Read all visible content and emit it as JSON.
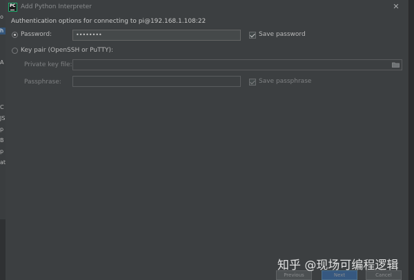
{
  "window": {
    "title": "Add Python Interpreter",
    "close_glyph": "✕"
  },
  "background_fragments": [
    "o",
    "h",
    "A",
    "C",
    "JS",
    "p",
    "B",
    "p",
    "at"
  ],
  "auth": {
    "header": "Authentication options for connecting to pi@192.168.1.108:22",
    "password_option": {
      "label": "Password:",
      "selected": true,
      "value": "••••••••",
      "save_label": "Save password",
      "save_checked": true
    },
    "keypair_option": {
      "label": "Key pair (OpenSSH or PuTTY):",
      "selected": false,
      "private_key_label": "Private key file:",
      "private_key_value": "",
      "passphrase_label": "Passphrase:",
      "passphrase_value": "",
      "save_passphrase_label": "Save passphrase",
      "save_passphrase_checked": true
    }
  },
  "footer": {
    "previous_label": "Previous",
    "next_label": "Next",
    "cancel_label": "Cancel"
  },
  "watermark": "知乎 @现场可编程逻辑",
  "colors": {
    "dialog_bg": "#3c3f41",
    "field_bg": "#45494a",
    "accent": "#365880",
    "text": "#bbbbbb"
  }
}
